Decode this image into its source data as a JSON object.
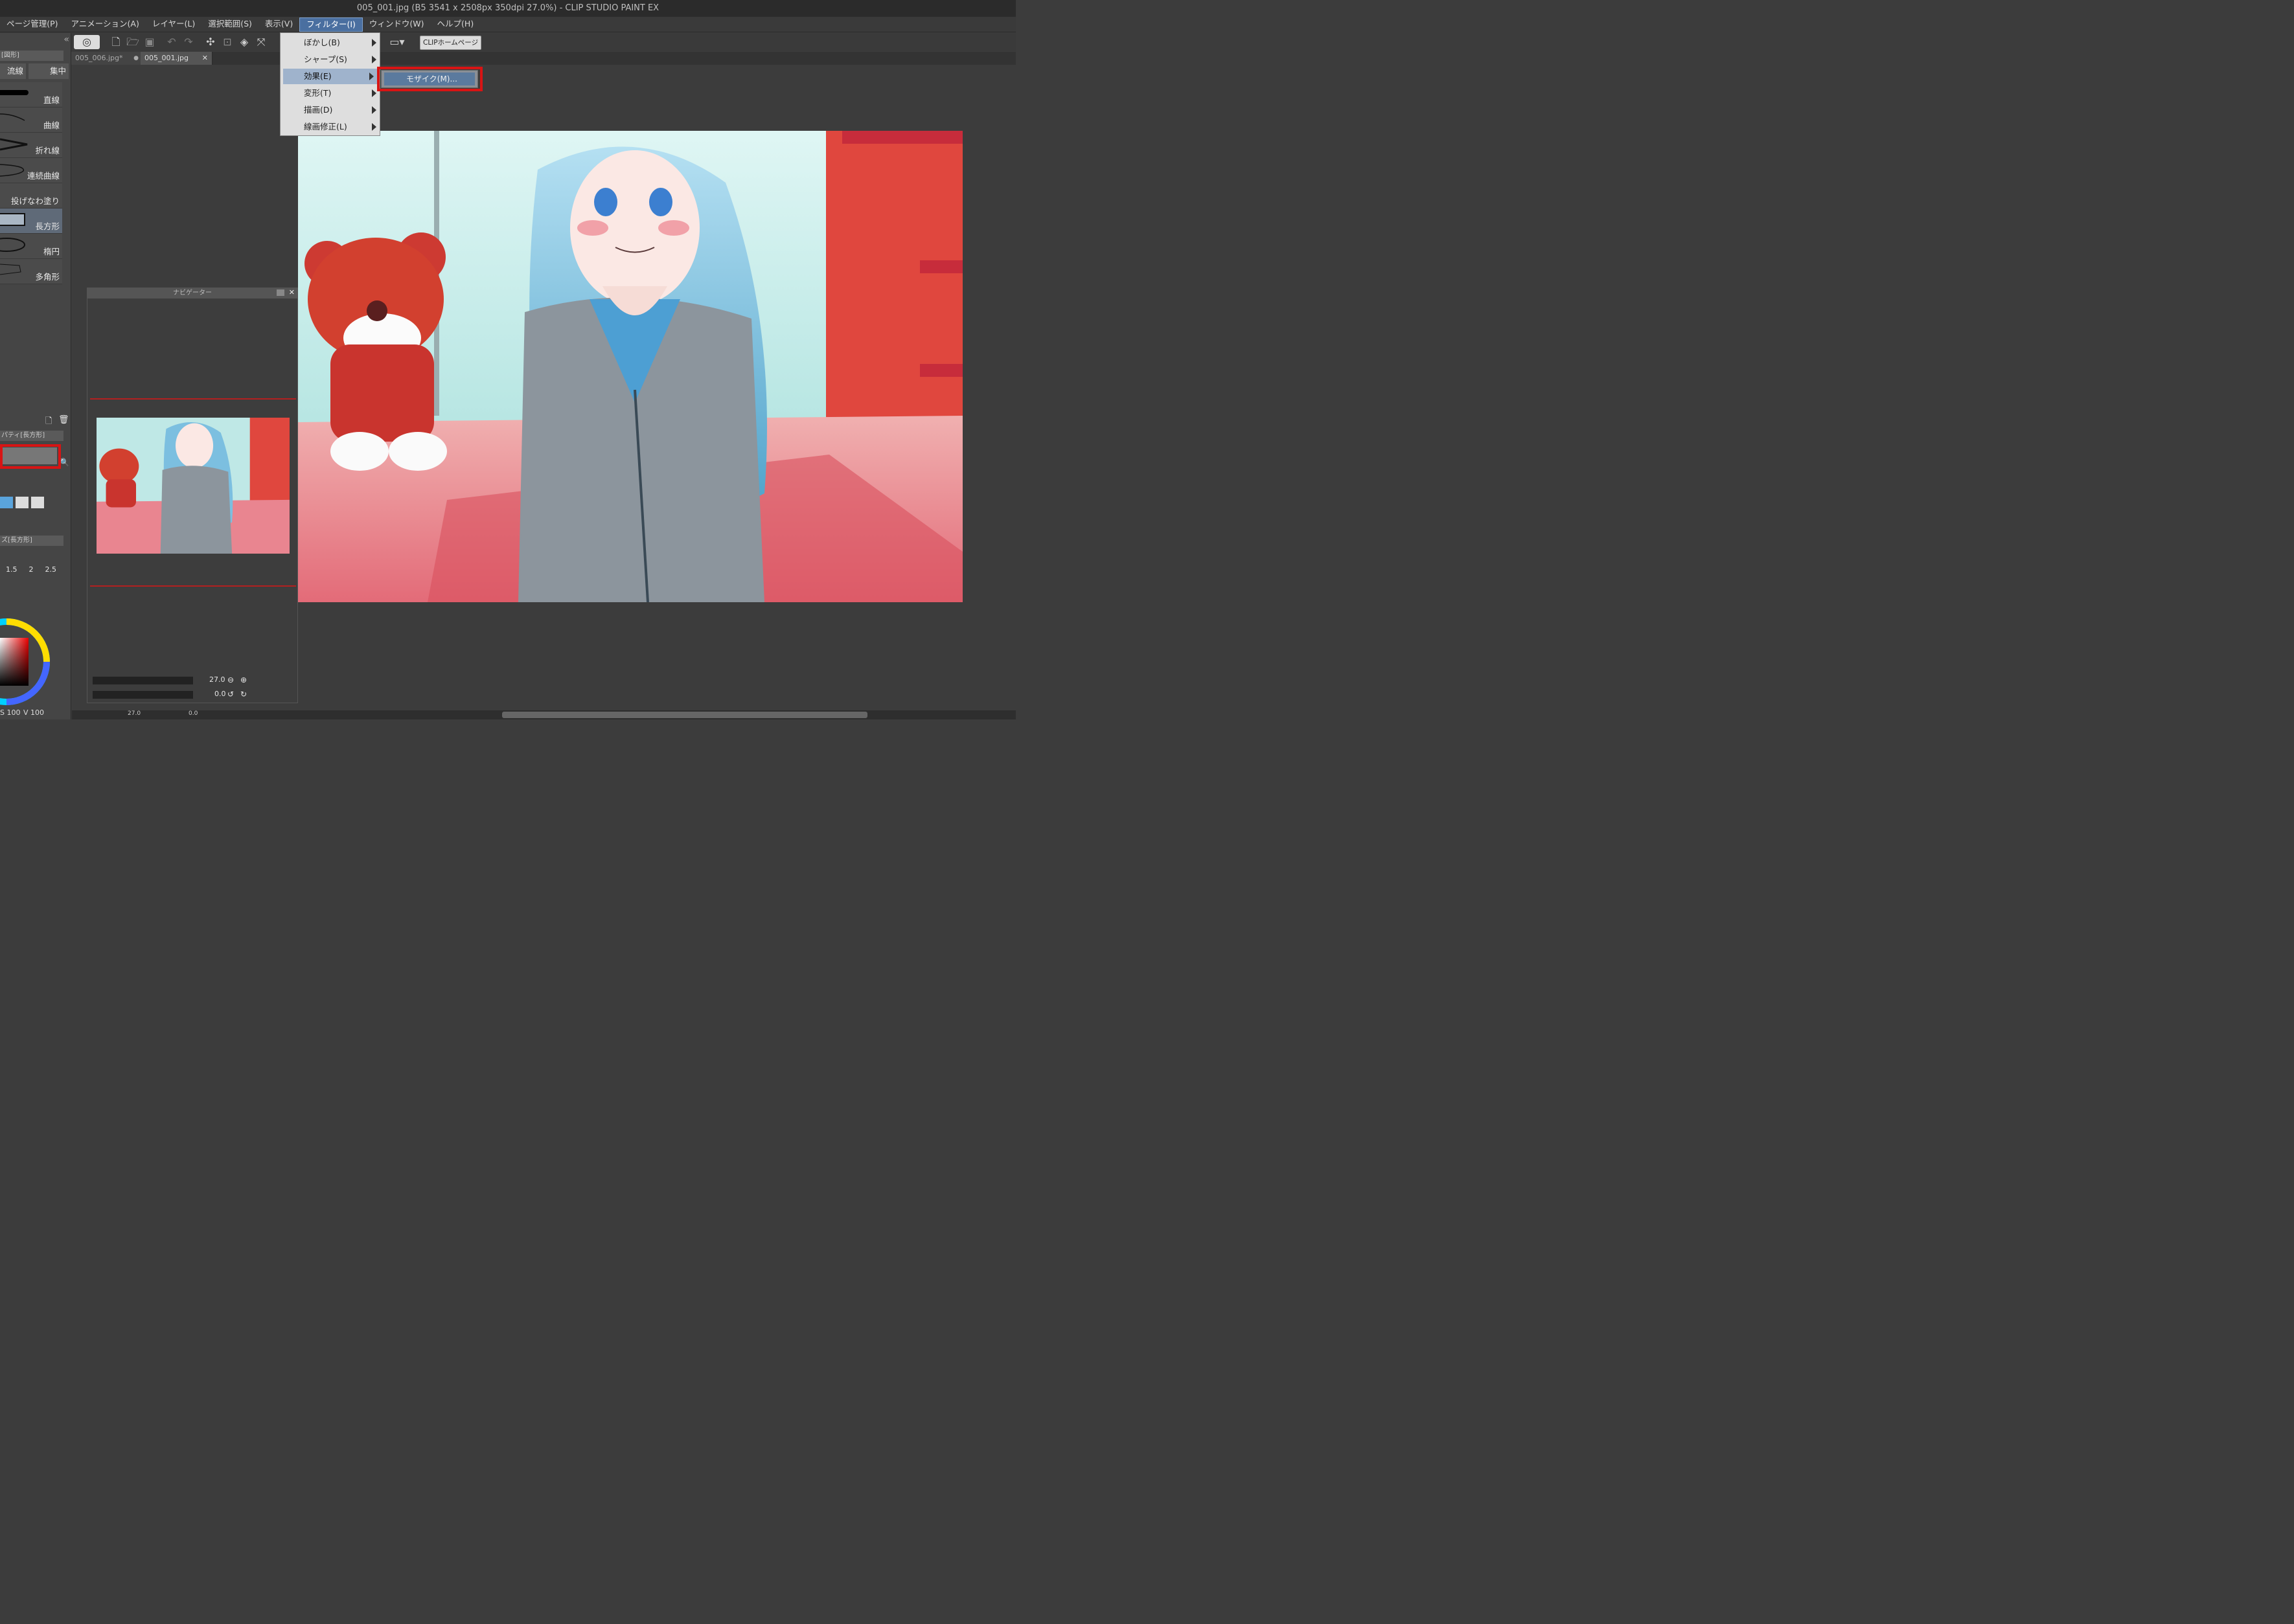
{
  "window": {
    "title": "005_001.jpg (B5 3541 x 2508px 350dpi 27.0%)  - CLIP STUDIO PAINT EX"
  },
  "menubar": {
    "items": [
      "ページ管理(P)",
      "アニメーション(A)",
      "レイヤー(L)",
      "選択範囲(S)",
      "表示(V)",
      "フィルター(I)",
      "ウィンドウ(W)",
      "ヘルプ(H)"
    ],
    "active": "フィルター(I)"
  },
  "toolbar": {
    "clip_home": "CLIPホームページ"
  },
  "tabs": [
    {
      "label": "005_006.jpg*",
      "close": "●"
    },
    {
      "label": "005_001.jpg",
      "close": "✕"
    }
  ],
  "filter_menu": {
    "items": [
      "ぼかし(B)",
      "シャープ(S)",
      "効果(E)",
      "変形(T)",
      "描画(D)",
      "線画修正(L)"
    ],
    "highlighted": "効果(E)",
    "submenu": {
      "item": "モザイク(M)..."
    }
  },
  "left_panel": {
    "header": "[図形]",
    "tabs": [
      "流線",
      "集中"
    ],
    "subtools": [
      "直線",
      "曲線",
      "折れ線",
      "連続曲線",
      "投げなわ塗り",
      "長方形",
      "楕円",
      "多角形"
    ],
    "selected_subtool": "長方形",
    "property_header": "パティ[長方形]",
    "brush_size_header": "ズ[長方形]",
    "brush_sizes": [
      "1.5",
      "2",
      "2.5"
    ],
    "color_s": "S 100",
    "color_v": "V 100"
  },
  "navigator": {
    "title": "ナビゲーター",
    "zoom": "27.0",
    "rotation": "0.0"
  },
  "statusbar": {
    "zoom": "27.0",
    "rotation": "0.0"
  },
  "colors": {
    "accent": "#4a6fa0",
    "highlight_box": "#d81414"
  }
}
